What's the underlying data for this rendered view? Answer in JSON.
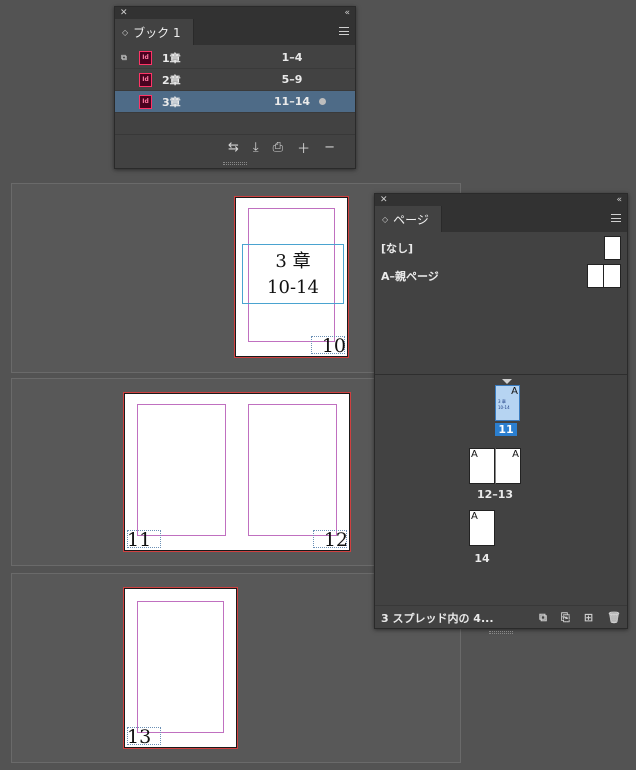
{
  "book_panel": {
    "tab_label": "ブック 1",
    "documents": [
      {
        "name": "1章",
        "range": "1–4",
        "selected": false
      },
      {
        "name": "2章",
        "range": "5–9",
        "selected": false
      },
      {
        "name": "3章",
        "range": "11–14",
        "selected": true
      }
    ],
    "icon_label": "Id"
  },
  "pages_panel": {
    "tab_label": "ページ",
    "masters": [
      {
        "name": "[なし]"
      },
      {
        "name": "A–親ページ"
      }
    ],
    "page_labels": {
      "p11": "11",
      "p12_13": "12–13",
      "p14": "14"
    },
    "thumb_master_letter": "A",
    "thumb11_text1": "3 章",
    "thumb11_text2": "10-14",
    "footer_status": "3 スプレッド内の 4..."
  },
  "pasteboard": {
    "title_line1": "3 章",
    "title_line2": "10-14",
    "page_numbers": [
      "10",
      "11",
      "12",
      "13"
    ]
  },
  "colors": {
    "panel_bg": "#424242",
    "selected_row": "#4e6b87",
    "selected_page": "#2b7fd0",
    "margin_guide": "#c070c0",
    "bleed_guide": "#d04040"
  }
}
